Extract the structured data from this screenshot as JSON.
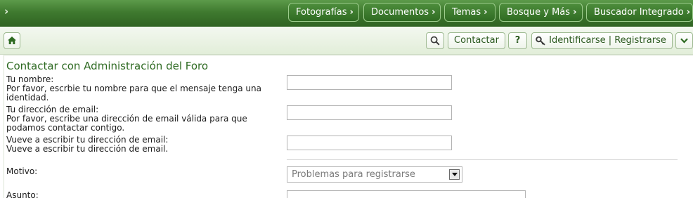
{
  "nav": {
    "tabs": [
      {
        "label": "Fotografías"
      },
      {
        "label": "Documentos"
      },
      {
        "label": "Temas"
      },
      {
        "label": "Bosque y Más"
      },
      {
        "label": "Buscador Integrado"
      }
    ]
  },
  "toolbar": {
    "contact_label": "Contactar",
    "help_label": "?",
    "login_label": "Identificarse | Registrarse"
  },
  "form": {
    "title": "Contactar con Administración del Foro",
    "name_label": "Tu nombre:",
    "name_hint": "Por favor, escrbie tu nombre para que el mensaje tenga una identidad.",
    "email_label": "Tu dirección de email:",
    "email_hint": "Por favor, escribe una dirección de email válida para que podamos contactar contigo.",
    "email2_label": "Vueve a escribir tu dirección de email:",
    "email2_hint": "Vueve a escribir tu dirección de email.",
    "motivo_label": "Motivo:",
    "motivo_value": "Problemas para registrarse",
    "asunto_label": "Asunto:"
  },
  "colors": {
    "brand_green": "#3f7a2f",
    "title_green": "#2e6a22"
  }
}
